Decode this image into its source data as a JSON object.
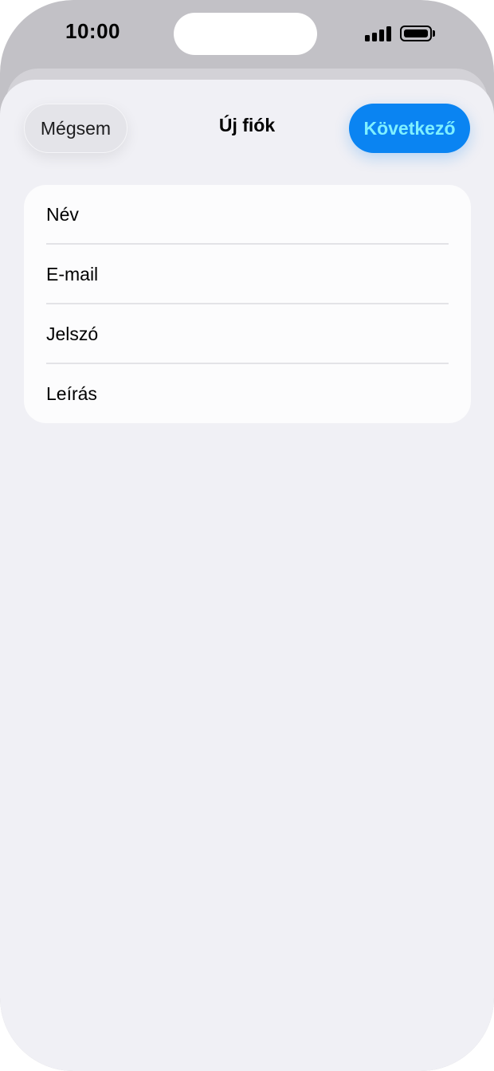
{
  "status_bar": {
    "time": "10:00",
    "icons": [
      "signal-icon",
      "battery-icon"
    ]
  },
  "header": {
    "cancel_label": "Mégsem",
    "title": "Új fiók",
    "next_label": "Következő"
  },
  "form": {
    "fields": [
      {
        "label": "Név"
      },
      {
        "label": "E-mail"
      },
      {
        "label": "Jelszó"
      },
      {
        "label": "Leírás"
      }
    ]
  },
  "colors": {
    "accent": "#0a84f2",
    "accent_text": "#7ff0ff",
    "sheet_background": "#f0f0f5",
    "card_background": "#fcfcfd"
  }
}
